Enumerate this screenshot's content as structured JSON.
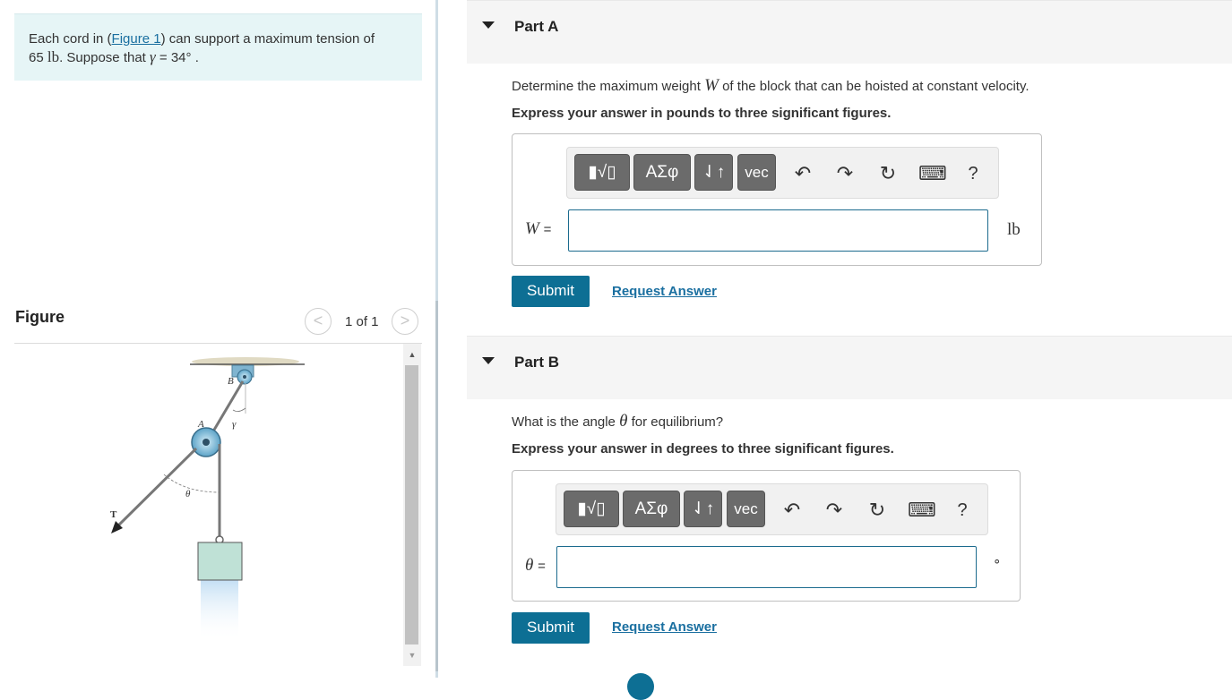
{
  "problem": {
    "text_before_link": "Each cord in (",
    "figure_link": "Figure 1",
    "text_after_link": ") can support a maximum tension of",
    "line2_value": "65",
    "line2_unit": "lb",
    "line2_suffix": ". Suppose that",
    "gamma_symbol": "γ",
    "gamma_value": "= 34°",
    "gamma_end": "."
  },
  "figure": {
    "title": "Figure",
    "page_count": "1 of 1",
    "prev_icon": "chevron-left-icon",
    "next_icon": "chevron-right-icon",
    "diagram_labels": {
      "b": "B",
      "a": "A",
      "gamma": "γ",
      "theta": "θ",
      "t": "T"
    }
  },
  "toolbar": {
    "templates_label": "▮√▯",
    "greek_label": "ΑΣφ",
    "arrows_label": "⇃↑",
    "vec_label": "vec",
    "undo_icon": "↶",
    "redo_icon": "↷",
    "reset_icon": "↻",
    "keyboard_icon": "⌨",
    "help_label": "?"
  },
  "part_a": {
    "title": "Part A",
    "question_pre": "Determine the maximum weight",
    "question_var": "W",
    "question_post": "of the block that can be hoisted at constant velocity.",
    "instruction": "Express your answer in pounds to three significant figures.",
    "var_symbol": "W",
    "var_eq": "=",
    "input_value": "",
    "unit": "lb",
    "submit_label": "Submit",
    "request_label": "Request Answer"
  },
  "part_b": {
    "title": "Part B",
    "question_pre": "What is the angle",
    "question_var": "θ",
    "question_post": "for equilibrium?",
    "instruction": "Express your answer in degrees to three significant figures.",
    "var_symbol": "θ",
    "var_eq": "=",
    "input_value": "",
    "unit": "∘",
    "submit_label": "Submit",
    "request_label": "Request Answer"
  }
}
